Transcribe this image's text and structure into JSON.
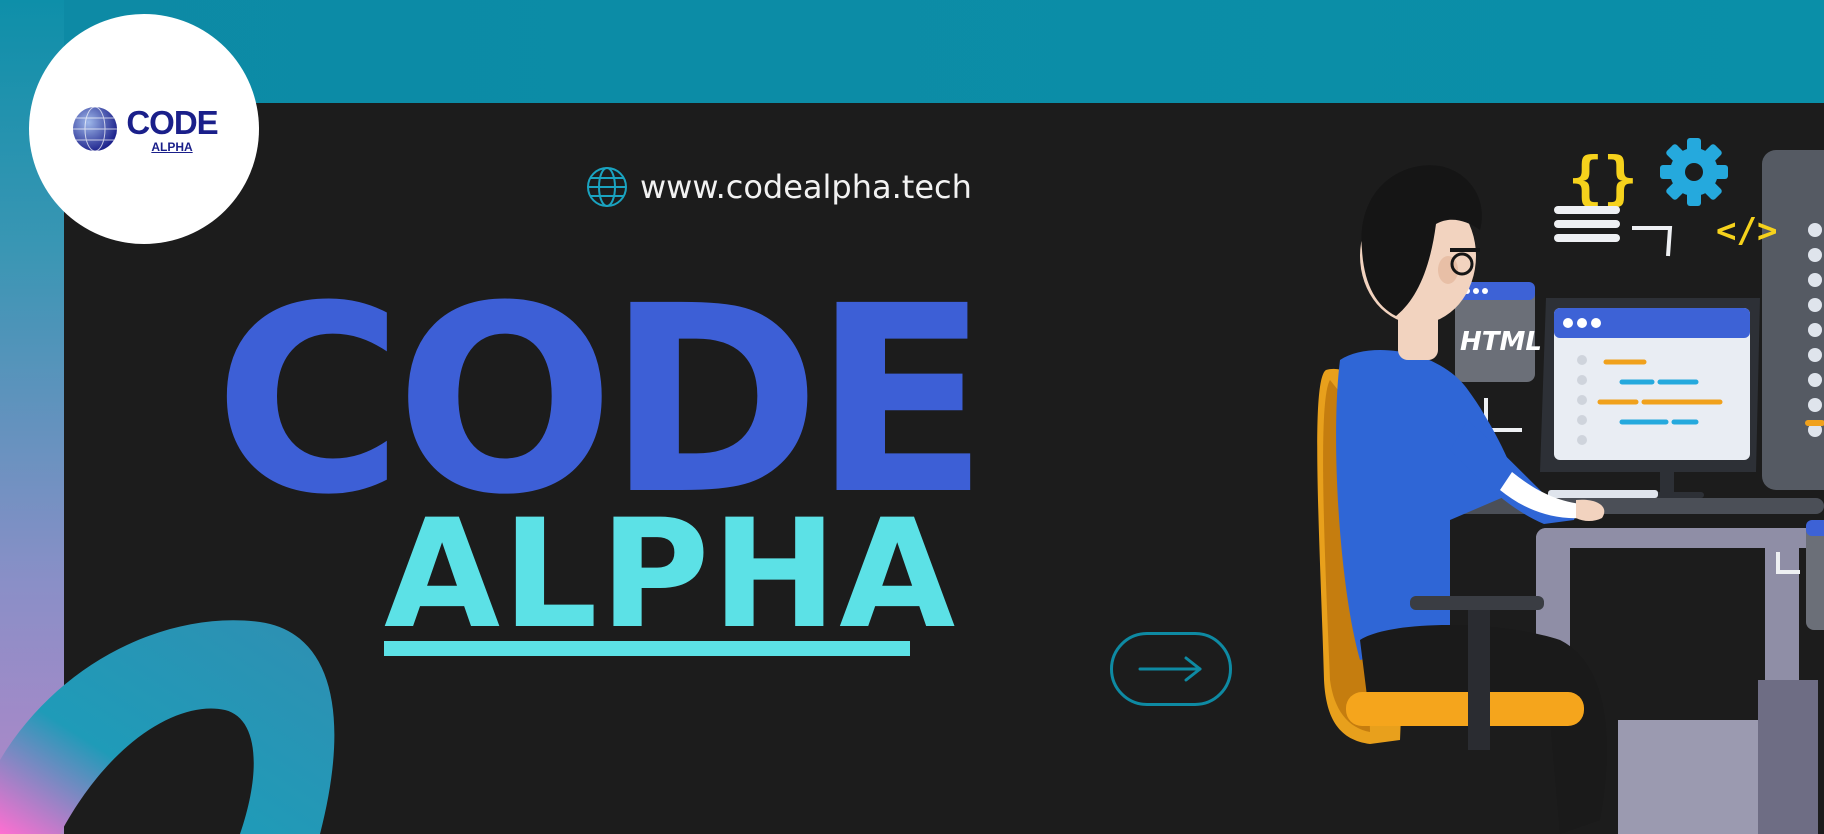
{
  "logo": {
    "code": "CODE",
    "alpha": "ALPHA"
  },
  "website": {
    "url": "www.codealpha.tech",
    "icon": "globe-icon"
  },
  "headline": {
    "code": "CODE",
    "alpha": "ALPHA"
  },
  "illustration": {
    "html_tag": "HTML",
    "icons": [
      "curly-braces-icon",
      "gear-icon",
      "code-tag-icon"
    ]
  },
  "cta": {
    "icon": "arrow-right-icon"
  },
  "colors": {
    "top_band": "#0a8fa8",
    "background": "#1c1c1c",
    "code_blue": "#3d5fd6",
    "alpha_cyan": "#5ce1e6",
    "logo_navy": "#1a1f8a",
    "cta_border": "#0e8aa3"
  }
}
